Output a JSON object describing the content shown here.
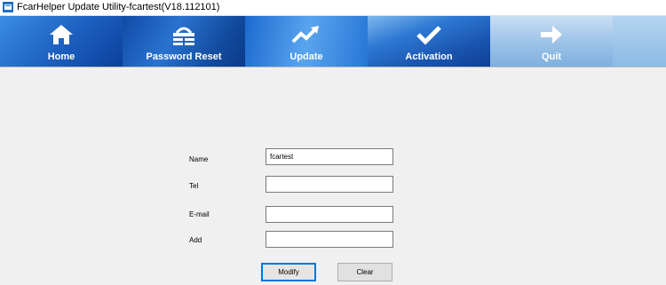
{
  "window": {
    "title": "FcarHelper Update Utility-fcartest(V18.112101)"
  },
  "toolbar": {
    "tabs": [
      {
        "label": "Home",
        "icon": "home-icon"
      },
      {
        "label": "Password Reset",
        "icon": "password-reset-icon"
      },
      {
        "label": "Update",
        "icon": "trend-up-icon"
      },
      {
        "label": "Activation",
        "icon": "checkmark-icon"
      },
      {
        "label": "Quit",
        "icon": "arrow-right-icon"
      }
    ]
  },
  "form": {
    "name_label": "Name",
    "name_value": "fcartest",
    "tel_label": "Tel",
    "tel_value": "",
    "email_label": "E-mail",
    "email_value": "",
    "add_label": "Add",
    "add_value": ""
  },
  "buttons": {
    "modify": "Modify",
    "clear": "Clear"
  },
  "colors": {
    "toolbar_blue": "#1b5fbd",
    "focus_border": "#0078d7"
  }
}
